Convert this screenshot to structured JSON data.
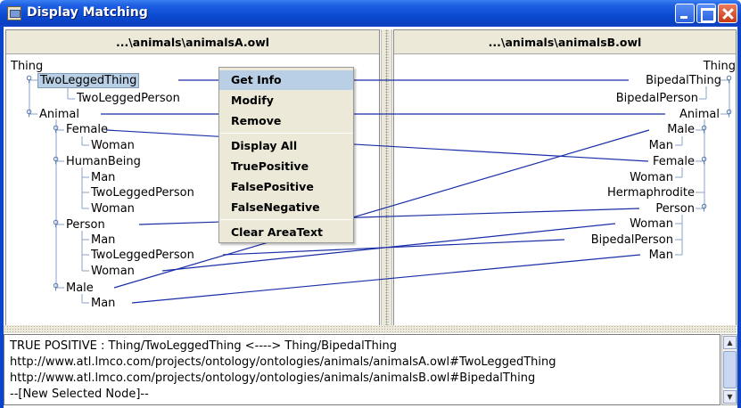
{
  "window": {
    "title": "Display Matching"
  },
  "left_panel": {
    "header": "...\\animals\\animalsA.owl",
    "nodes": [
      {
        "label": "Thing"
      },
      {
        "label": "TwoLeggedThing"
      },
      {
        "label": "TwoLeggedPerson"
      },
      {
        "label": "Animal"
      },
      {
        "label": "Female"
      },
      {
        "label": "Woman"
      },
      {
        "label": "HumanBeing"
      },
      {
        "label": "Man"
      },
      {
        "label": "TwoLeggedPerson"
      },
      {
        "label": "Woman"
      },
      {
        "label": "Person"
      },
      {
        "label": "Man"
      },
      {
        "label": "TwoLeggedPerson"
      },
      {
        "label": "Woman"
      },
      {
        "label": "Male"
      },
      {
        "label": "Man"
      }
    ]
  },
  "right_panel": {
    "header": "...\\animals\\animalsB.owl",
    "nodes": [
      {
        "label": "Thing"
      },
      {
        "label": "BipedalThing"
      },
      {
        "label": "BipedalPerson"
      },
      {
        "label": "Animal"
      },
      {
        "label": "Male"
      },
      {
        "label": "Man"
      },
      {
        "label": "Female"
      },
      {
        "label": "Woman"
      },
      {
        "label": "Hermaphrodite"
      },
      {
        "label": "Person"
      },
      {
        "label": "Woman"
      },
      {
        "label": "BipedalPerson"
      },
      {
        "label": "Man"
      }
    ]
  },
  "context_menu": {
    "items": [
      {
        "label": "Get Info"
      },
      {
        "label": "Modify"
      },
      {
        "label": "Remove"
      },
      {
        "label": "Display All"
      },
      {
        "label": "TruePositive"
      },
      {
        "label": "FalsePositive"
      },
      {
        "label": "FalseNegative"
      },
      {
        "label": "Clear AreaText"
      }
    ]
  },
  "text_area": {
    "lines": [
      "TRUE POSITIVE : Thing/TwoLeggedThing <----> Thing/BipedalThing",
      "http://www.atl.lmco.com/projects/ontology/ontologies/animals/animalsA.owl#TwoLeggedThing",
      "http://www.atl.lmco.com/projects/ontology/ontologies/animals/animalsB.owl#BipedalThing",
      "--[New Selected Node]--"
    ]
  },
  "colors": {
    "titlebar": "#0b45cc",
    "selection": "#b8cfe5",
    "link_line": "#1a2ea8",
    "tree_line": "#8aa0c8"
  },
  "icons": {
    "expand": "key-handle-icon",
    "scroll_up": "arrow-up-icon",
    "scroll_down": "arrow-down-icon"
  }
}
